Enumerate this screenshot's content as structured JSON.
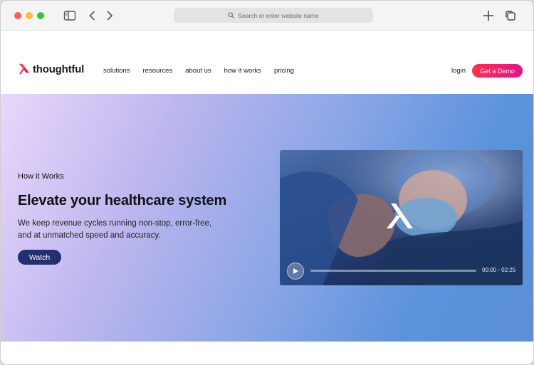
{
  "browser": {
    "address_placeholder": "Search or enter website name"
  },
  "site": {
    "logo_text": "thoughtful",
    "nav": [
      "solutions",
      "resources",
      "about us",
      "how it works",
      "pricing"
    ],
    "login_label": "login",
    "demo_label": "Get a Demo"
  },
  "hero": {
    "eyebrow": "How it Works",
    "headline": "Elevate your healthcare system",
    "subcopy": "We keep revenue cycles running non-stop, error-free, and at unmatched speed and accuracy.",
    "watch_label": "Watch"
  },
  "video": {
    "time_display": "00:00 - 02:25",
    "progress": 0.0
  },
  "colors": {
    "brand_gradient_start": "#ff2e4d",
    "brand_gradient_end": "#e0148a",
    "watch_button": "#22306f"
  },
  "icons": {
    "sidebar": "sidebar-icon",
    "back": "chevron-left-icon",
    "forward": "chevron-right-icon",
    "search": "search-icon",
    "new_tab": "plus-icon",
    "tabs": "tabs-icon",
    "play": "play-icon"
  }
}
